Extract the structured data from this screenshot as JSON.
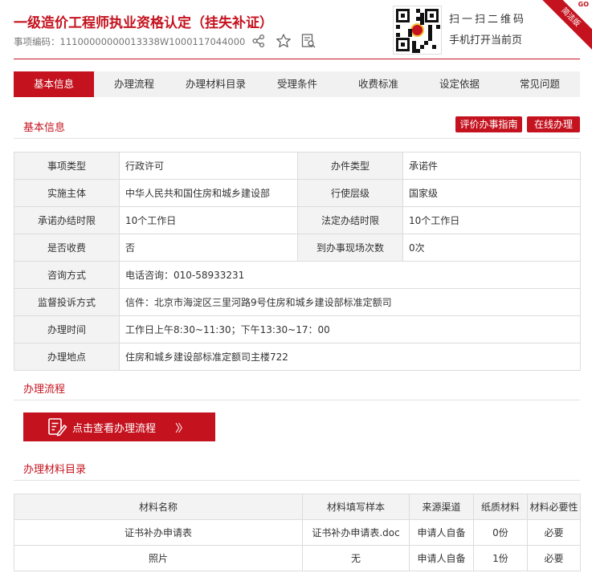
{
  "header": {
    "title": "一级造价工程师执业资格认定（挂失补证）",
    "code_label": "事项编码：",
    "code_value": "11100000000013338W1000117044000",
    "scan_title": "扫一扫二维码",
    "scan_subtitle": "手机打开当前页",
    "corner_badge": "简洁版",
    "corner_go": "GO",
    "icons": [
      "share-icon",
      "star-icon",
      "search-doc-icon"
    ]
  },
  "tabs": [
    {
      "label": "基本信息",
      "active": true
    },
    {
      "label": "办理流程",
      "active": false
    },
    {
      "label": "办理材料目录",
      "active": false
    },
    {
      "label": "受理条件",
      "active": false
    },
    {
      "label": "收费标准",
      "active": false
    },
    {
      "label": "设定依据",
      "active": false
    },
    {
      "label": "常见问题",
      "active": false
    }
  ],
  "basic_info": {
    "title": "基本信息",
    "buttons": {
      "evaluate": "评价办事指南",
      "online": "在线办理"
    },
    "pairs": [
      {
        "l1": "事项类型",
        "v1": "行政许可",
        "l2": "办件类型",
        "v2": "承诺件"
      },
      {
        "l1": "实施主体",
        "v1": "中华人民共和国住房和城乡建设部",
        "l2": "行使层级",
        "v2": "国家级"
      },
      {
        "l1": "承诺办结时限",
        "v1": "10个工作日",
        "l2": "法定办结时限",
        "v2": "10个工作日"
      },
      {
        "l1": "是否收费",
        "v1": "否",
        "l2": "到办事现场次数",
        "v2": "0次"
      }
    ],
    "singles": [
      {
        "label": "咨询方式",
        "value": "电话咨询：010-58933231"
      },
      {
        "label": "监督投诉方式",
        "value": "信件：北京市海淀区三里河路9号住房和城乡建设部标准定额司"
      },
      {
        "label": "办理时间",
        "value": "工作日上午8:30~11:30；下午13:30~17：00"
      },
      {
        "label": "办理地点",
        "value": "住房和城乡建设部标准定额司主楼722"
      }
    ]
  },
  "process": {
    "title": "办理流程",
    "button_label": "点击查看办理流程",
    "button_arrow": "〉〉"
  },
  "materials": {
    "title": "办理材料目录",
    "headers": [
      "材料名称",
      "材料填写样本",
      "来源渠道",
      "纸质材料",
      "材料必要性"
    ],
    "rows": [
      [
        "证书补办申请表",
        "证书补办申请表.doc",
        "申请人自备",
        "0份",
        "必要"
      ],
      [
        "照片",
        "无",
        "申请人自备",
        "1份",
        "必要"
      ]
    ]
  },
  "colors": {
    "accent": "#c4131f",
    "label_bg": "#f3f3f3",
    "tab_bg": "#f1f1f1"
  }
}
